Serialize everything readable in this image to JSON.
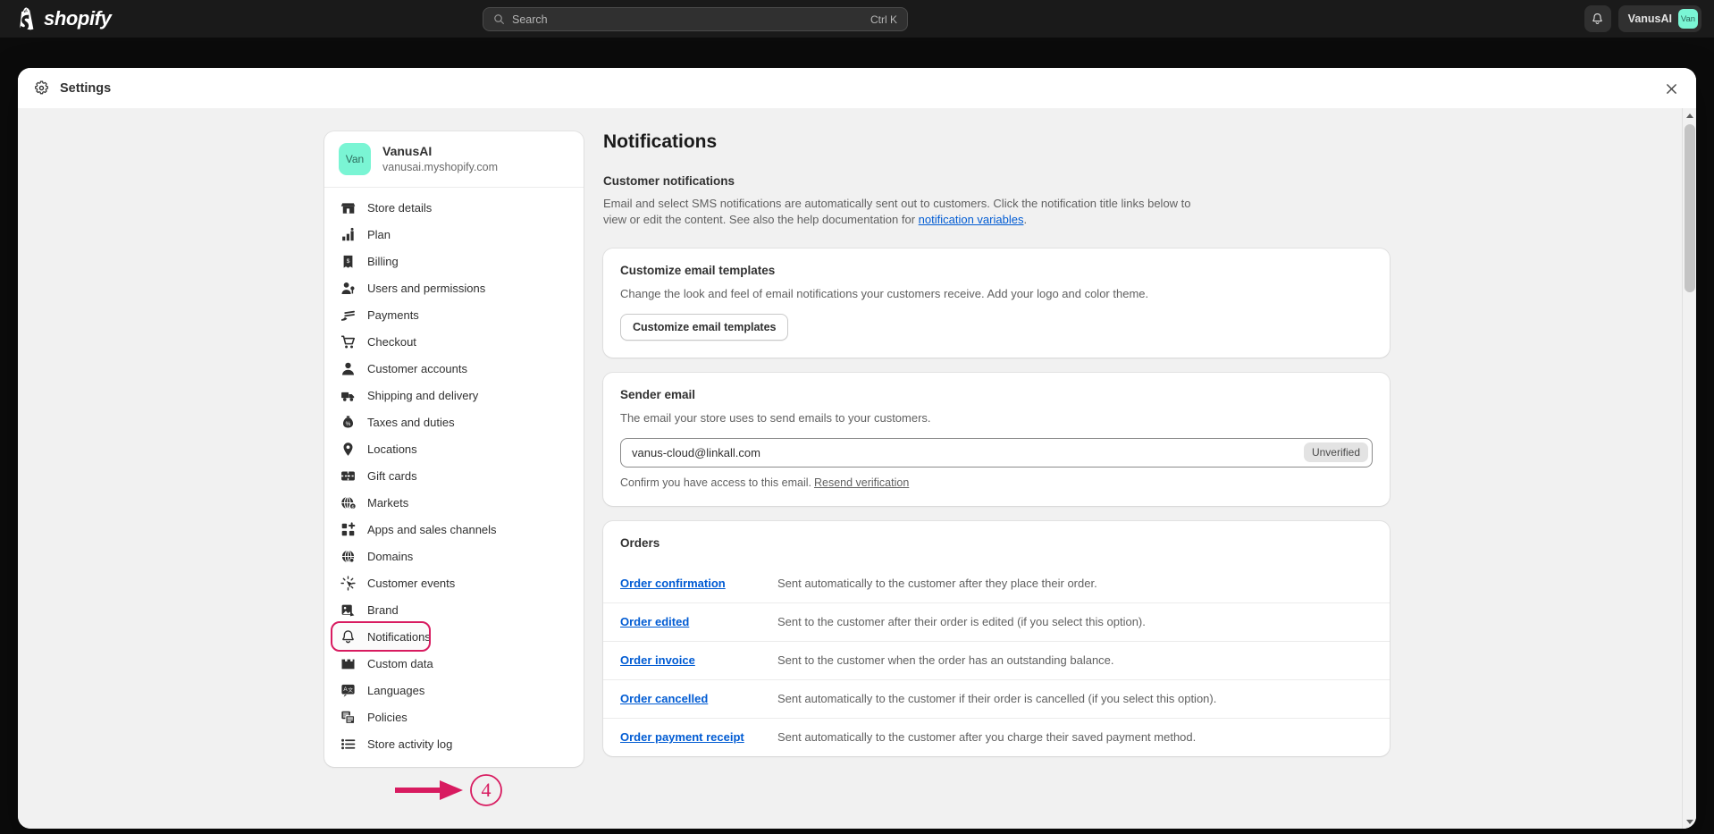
{
  "topbar": {
    "logo_text": "shopify",
    "search": {
      "placeholder": "Search",
      "shortcut": "Ctrl K"
    },
    "user": {
      "name": "VanusAI",
      "avatar_initials": "Van"
    }
  },
  "modal": {
    "title": "Settings",
    "close_label": "×"
  },
  "sidebar": {
    "store": {
      "name": "VanusAI",
      "domain": "vanusai.myshopify.com",
      "avatar_initials": "Van"
    },
    "items": [
      {
        "label": "Store details",
        "icon": "store-icon"
      },
      {
        "label": "Plan",
        "icon": "plan-icon"
      },
      {
        "label": "Billing",
        "icon": "billing-icon"
      },
      {
        "label": "Users and permissions",
        "icon": "users-icon"
      },
      {
        "label": "Payments",
        "icon": "payments-icon"
      },
      {
        "label": "Checkout",
        "icon": "checkout-cart-icon"
      },
      {
        "label": "Customer accounts",
        "icon": "person-icon"
      },
      {
        "label": "Shipping and delivery",
        "icon": "truck-icon"
      },
      {
        "label": "Taxes and duties",
        "icon": "tax-icon"
      },
      {
        "label": "Locations",
        "icon": "location-pin-icon"
      },
      {
        "label": "Gift cards",
        "icon": "gift-card-icon"
      },
      {
        "label": "Markets",
        "icon": "globe-currency-icon"
      },
      {
        "label": "Apps and sales channels",
        "icon": "apps-icon"
      },
      {
        "label": "Domains",
        "icon": "domain-globe-icon"
      },
      {
        "label": "Customer events",
        "icon": "cursor-click-icon"
      },
      {
        "label": "Brand",
        "icon": "brand-image-icon"
      },
      {
        "label": "Notifications",
        "icon": "bell-icon"
      },
      {
        "label": "Custom data",
        "icon": "custom-data-icon"
      },
      {
        "label": "Languages",
        "icon": "languages-icon"
      },
      {
        "label": "Policies",
        "icon": "policies-icon"
      },
      {
        "label": "Store activity log",
        "icon": "activity-log-icon"
      }
    ],
    "active_index": 16
  },
  "annotation": {
    "step_number": "4",
    "color": "#d81b60"
  },
  "main": {
    "page_title": "Notifications",
    "customer_notifications": {
      "heading": "Customer notifications",
      "description_part1": "Email and select SMS notifications are automatically sent out to customers. Click the notification title links below to view or edit the content. See also the help documentation for ",
      "link_text": "notification variables",
      "description_part2": "."
    },
    "customize_card": {
      "title": "Customize email templates",
      "text": "Change the look and feel of email notifications your customers receive. Add your logo and color theme.",
      "button_label": "Customize email templates"
    },
    "sender_email_card": {
      "title": "Sender email",
      "text": "The email your store uses to send emails to your customers.",
      "email_value": "vanus-cloud@linkall.com",
      "badge": "Unverified",
      "confirm_text": "Confirm you have access to this email.",
      "resend_link": "Resend verification"
    },
    "orders_card": {
      "title": "Orders",
      "rows": [
        {
          "name": "Order confirmation",
          "description": "Sent automatically to the customer after they place their order."
        },
        {
          "name": "Order edited",
          "description": "Sent to the customer after their order is edited (if you select this option)."
        },
        {
          "name": "Order invoice",
          "description": "Sent to the customer when the order has an outstanding balance."
        },
        {
          "name": "Order cancelled",
          "description": "Sent automatically to the customer if their order is cancelled (if you select this option)."
        },
        {
          "name": "Order payment receipt",
          "description": "Sent automatically to the customer after you charge their saved payment method."
        }
      ]
    }
  },
  "colors": {
    "link": "#005bd3",
    "accent_mint": "#7af5d4",
    "annotation": "#d81b60",
    "topbar_bg": "#1a1a1a"
  }
}
